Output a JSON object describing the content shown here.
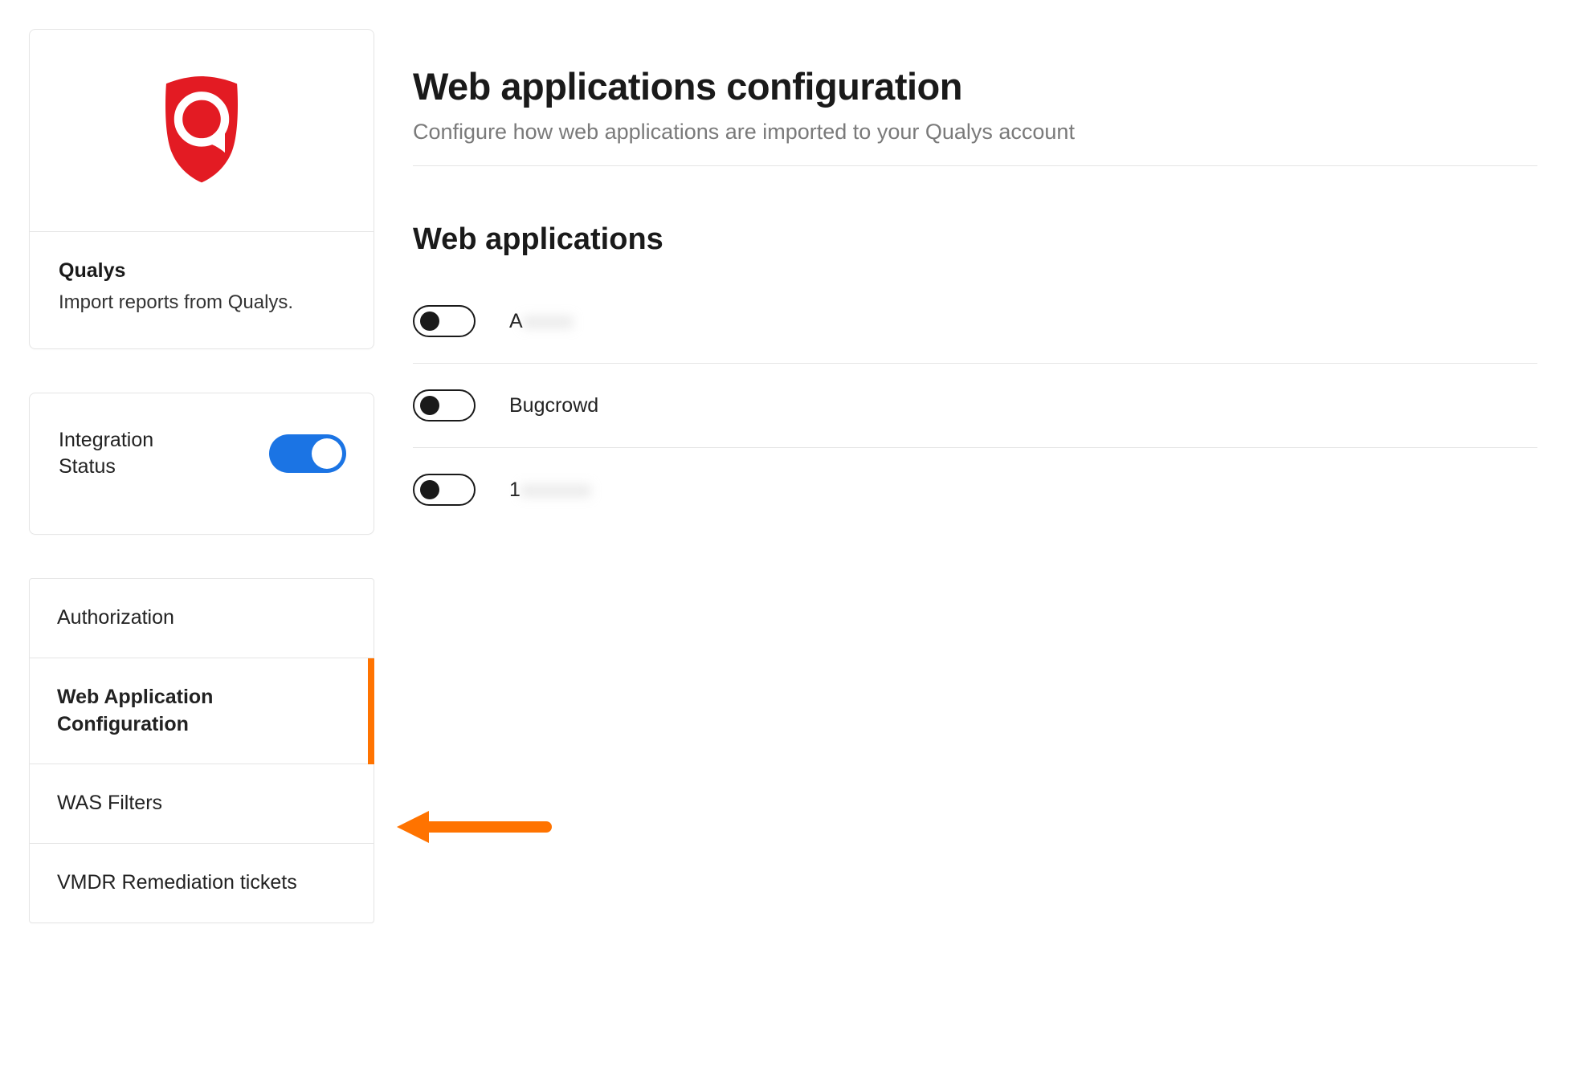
{
  "sidebar": {
    "qualys": {
      "title": "Qualys",
      "desc": "Import reports from Qualys."
    },
    "integration_status": {
      "label": "Integration Status",
      "enabled": true
    },
    "nav": [
      {
        "label": "Authorization",
        "active": false
      },
      {
        "label": "Web Application Configuration",
        "active": true
      },
      {
        "label": "WAS Filters",
        "active": false
      },
      {
        "label": "VMDR Remediation tickets",
        "active": false
      }
    ]
  },
  "main": {
    "title": "Web applications configuration",
    "subtitle": "Configure how web applications are imported to your Qualys account",
    "section_heading": "Web applications",
    "apps": [
      {
        "prefix": "A",
        "obscured": "xxxxx",
        "enabled": false
      },
      {
        "prefix": "Bugcrowd",
        "obscured": "",
        "enabled": false
      },
      {
        "prefix": "1",
        "obscured": "xxxxxxx",
        "enabled": false
      }
    ]
  },
  "colors": {
    "accent_orange": "#ff7300",
    "qualys_red": "#e31b23",
    "toggle_blue": "#1b74e4"
  }
}
